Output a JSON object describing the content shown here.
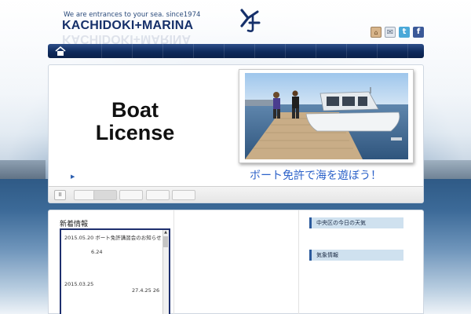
{
  "header": {
    "tagline": "We are entrances to your sea.   since1974",
    "logo_text": "KACHIDOKI",
    "logo_join": "+",
    "logo_text2": "MARINA",
    "logo_icon": "anchor-mark-icon",
    "brand_color": "#16306a"
  },
  "social": {
    "home_icon": "home-icon",
    "mail_icon": "mail-icon",
    "twitter_icon": "twitter-icon",
    "twitter_glyph": "t",
    "facebook_icon": "facebook-icon",
    "facebook_glyph": "f"
  },
  "nav": {
    "home_icon": "home-icon",
    "bar_color": "#0e2a5c"
  },
  "slider": {
    "title_line1": "Boat",
    "title_line2": "License",
    "caption": "ボート免許で海を遊ぼう！",
    "caption_color": "#2c62c9",
    "pause_label": "II",
    "active_thumb": 2,
    "thumb_count": 5
  },
  "news": {
    "title": "新着情報",
    "items": [
      {
        "date": "2015.05.20",
        "title": "ボート免許講習会のお知らせ",
        "sub": "6.24"
      },
      {
        "date": "2015.03.25",
        "title": "",
        "sub": "27.4.25  26"
      }
    ]
  },
  "sidebar": {
    "weather_title": "中央区の今日の天気",
    "info_title": "気象情報"
  }
}
